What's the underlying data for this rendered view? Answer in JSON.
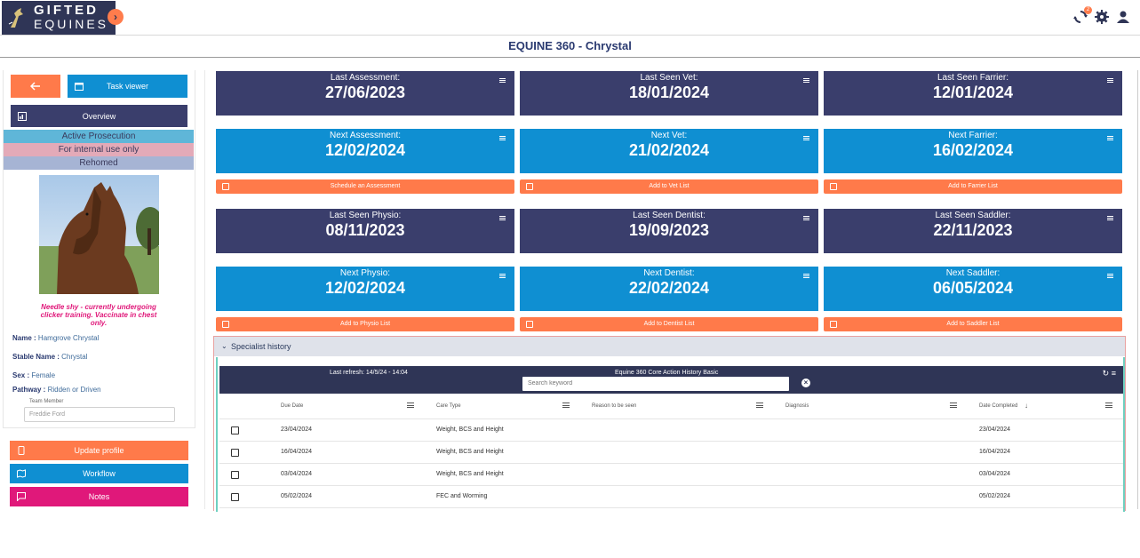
{
  "app": {
    "logo_line1": "GIFTED",
    "logo_line2": "EQUINES",
    "notification_count": "2"
  },
  "page_title": "EQUINE 360 - Chrystal",
  "sidebar": {
    "task_viewer_label": "Task viewer",
    "overview_label": "Overview",
    "tags": [
      "Active Prosecution",
      "For internal use only",
      "Rehomed"
    ],
    "tag_colors": [
      "#5fb6d8",
      "#e3aab8",
      "#a6b4d4"
    ],
    "note": "Needle shy - currently undergoing clicker training. Vaccinate in chest only.",
    "name_label": "Name :",
    "name_value": "Hamgrove Chrystal",
    "stable_label": "Stable Name :",
    "stable_value": "Chrystal",
    "sex_label": "Sex :",
    "sex_value": "Female",
    "pathway_label": "Pathway :",
    "pathway_value": "Ridden or Driven",
    "team_member_label": "Team Member",
    "team_member_value": "Freddie Ford",
    "update_profile_label": "Update profile",
    "workflow_label": "Workflow",
    "notes_label": "Notes"
  },
  "cards": {
    "last_assessment": {
      "label": "Last Assessment:",
      "value": "27/06/2023"
    },
    "last_vet": {
      "label": "Last Seen Vet:",
      "value": "18/01/2024"
    },
    "last_farrier": {
      "label": "Last Seen Farrier:",
      "value": "12/01/2024"
    },
    "next_assessment": {
      "label": "Next Assessment:",
      "value": "12/02/2024"
    },
    "next_vet": {
      "label": "Next Vet:",
      "value": "21/02/2024"
    },
    "next_farrier": {
      "label": "Next Farrier:",
      "value": "16/02/2024"
    },
    "last_physio": {
      "label": "Last Seen Physio:",
      "value": "08/11/2023"
    },
    "last_dentist": {
      "label": "Last Seen Dentist:",
      "value": "19/09/2023"
    },
    "last_saddler": {
      "label": "Last Seen Saddler:",
      "value": "22/11/2023"
    },
    "next_physio": {
      "label": "Next Physio:",
      "value": "12/02/2024"
    },
    "next_dentist": {
      "label": "Next Dentist:",
      "value": "22/02/2024"
    },
    "next_saddler": {
      "label": "Next Saddler:",
      "value": "06/05/2024"
    }
  },
  "actions": {
    "schedule_assessment": "Schedule an Assessment",
    "add_vet": "Add to Vet List",
    "add_farrier": "Add to Farrier List",
    "add_physio": "Add to Physio List",
    "add_dentist": "Add to Dentist List",
    "add_saddler": "Add to Saddler List"
  },
  "specialist": {
    "title": "Specialist history",
    "last_refresh": "Last refresh: 14/5/24 - 14:04",
    "grid_title": "Equine 360 Core Action History Basic",
    "search_placeholder": "Search keyword",
    "columns": [
      "Due Date",
      "Care Type",
      "Reason to be seen",
      "Diagnosis",
      "Date Completed"
    ],
    "rows": [
      {
        "due": "23/04/2024",
        "type": "Weight, BCS and Height",
        "reason": "",
        "diagnosis": "",
        "completed": "23/04/2024"
      },
      {
        "due": "16/04/2024",
        "type": "Weight, BCS and Height",
        "reason": "",
        "diagnosis": "",
        "completed": "16/04/2024"
      },
      {
        "due": "03/04/2024",
        "type": "Weight, BCS and Height",
        "reason": "",
        "diagnosis": "",
        "completed": "03/04/2024"
      },
      {
        "due": "05/02/2024",
        "type": "FEC and Worming",
        "reason": "",
        "diagnosis": "",
        "completed": "05/02/2024"
      }
    ]
  },
  "colors": {
    "dark_card": "#3a3e6c",
    "blue_card": "#0f8fd2",
    "orange": "#ff7a4a",
    "pink": "#e0187a"
  }
}
